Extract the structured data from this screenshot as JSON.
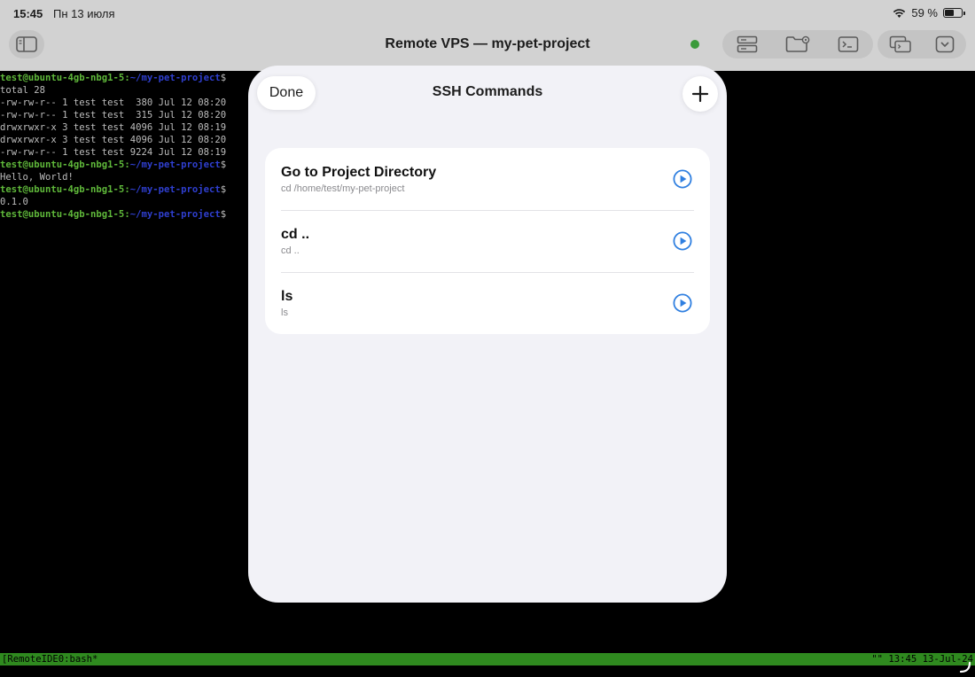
{
  "status_bar": {
    "time": "15:45",
    "date": "Пн 13 июля",
    "battery": "59 %",
    "battery_level": 0.59
  },
  "toolbar": {
    "title": "Remote VPS — my-pet-project",
    "connection_color": "#3a9a3a"
  },
  "terminal": {
    "prompt_user": "test@ubuntu-4gb-nbg1-5:",
    "prompt_path": "~/my-pet-project",
    "prompt_symbol": "$",
    "lines": [
      {
        "type": "prompt"
      },
      {
        "type": "output",
        "text": "total 28"
      },
      {
        "type": "output",
        "text": "-rw-rw-r-- 1 test test  380 Jul 12 08:20"
      },
      {
        "type": "output",
        "text": "-rw-rw-r-- 1 test test  315 Jul 12 08:20"
      },
      {
        "type": "output",
        "text": "drwxrwxr-x 3 test test 4096 Jul 12 08:19"
      },
      {
        "type": "output",
        "text": "drwxrwxr-x 3 test test 4096 Jul 12 08:20"
      },
      {
        "type": "output",
        "text": "-rw-rw-r-- 1 test test 9224 Jul 12 08:19"
      },
      {
        "type": "prompt"
      },
      {
        "type": "output",
        "text": "Hello, World!"
      },
      {
        "type": "prompt"
      },
      {
        "type": "output",
        "text": "0.1.0"
      },
      {
        "type": "prompt"
      }
    ],
    "tmux_left": "[RemoteIDE0:bash*",
    "tmux_right": "\"\" 13:45 13-Jul-24"
  },
  "sheet": {
    "done_label": "Done",
    "title": "SSH Commands",
    "commands": [
      {
        "name": "Go to Project Directory",
        "command": "cd /home/test/my-pet-project"
      },
      {
        "name": "cd ..",
        "command": "cd .."
      },
      {
        "name": "ls",
        "command": "ls"
      }
    ]
  },
  "icons": {
    "sidebar": "sidebar-toggle-icon",
    "server": "server-icon",
    "folder": "folder-settings-icon",
    "terminal": "terminal-icon",
    "windows": "windows-icon",
    "chevron": "chevron-down-icon",
    "add": "plus-icon",
    "run": "play-circle-icon"
  },
  "colors": {
    "accent": "#2f7fe0",
    "tmux_bar": "#2f8a1f"
  }
}
